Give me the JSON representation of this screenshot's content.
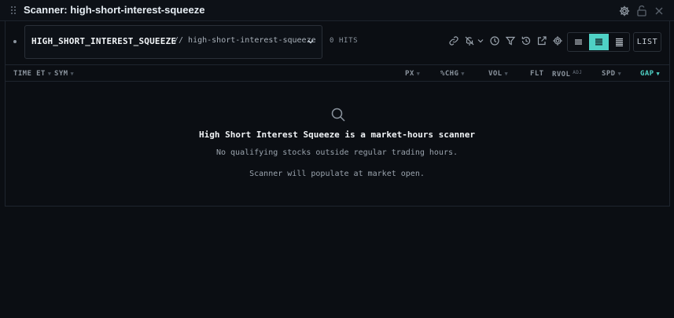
{
  "window": {
    "title": "Scanner: high-short-interest-squeeze",
    "icons": [
      "drag-handle-icon",
      "gear-icon",
      "unlock-icon",
      "close-icon"
    ]
  },
  "toolbar": {
    "scanner_name": "HIGH_SHORT_INTEREST_SQUEEZE",
    "scanner_slug": "// high-short-interest-squeeze",
    "hits": "0 HITS",
    "icons": [
      "link-icon",
      "bell-off-icon",
      "chevron-down-icon",
      "clock-icon",
      "filter-icon",
      "history-icon",
      "external-link-icon",
      "gear-icon"
    ],
    "view_modes": [
      "compact",
      "default",
      "comfortable"
    ],
    "active_view": "default",
    "list_label": "LIST"
  },
  "columns": {
    "time": "TIME ET",
    "sym": "SYM",
    "px": "PX",
    "chg": "%CHG",
    "vol": "VOL",
    "flt": "FLT",
    "rvol": "RVOL",
    "rvol_sup": "ADJ",
    "spd": "SPD",
    "gap": "GAP",
    "active_sort": "GAP"
  },
  "empty_state": {
    "icon": "search-icon",
    "title": "High Short Interest Squeeze is a market-hours scanner",
    "line1": "No qualifying stocks outside regular trading hours.",
    "line2": "Scanner will populate at market open."
  },
  "colors": {
    "background": "#0b0e13",
    "accent": "#4fd1c5",
    "text": "#c9d1d9",
    "muted": "#8b949e"
  }
}
